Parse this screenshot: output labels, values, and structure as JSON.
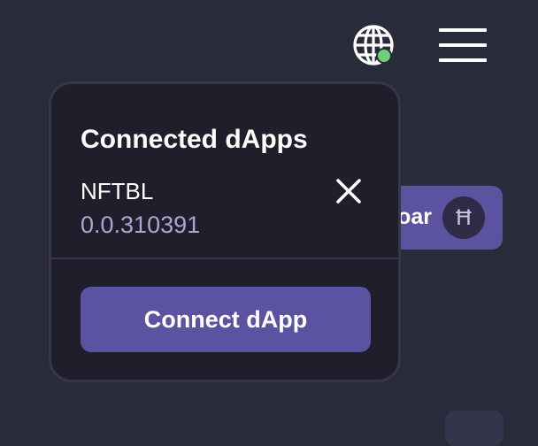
{
  "header": {
    "globe_icon": "globe-icon",
    "status_color": "#6fcf79",
    "menu_icon": "hamburger-menu-icon"
  },
  "account_pill": {
    "text_fragment": "oar",
    "currency_symbol": "Ħ"
  },
  "popover": {
    "title": "Connected dApps",
    "items": [
      {
        "name": "NFTBL",
        "account_id": "0.0.310391"
      }
    ],
    "connect_label": "Connect dApp"
  },
  "colors": {
    "background": "#2a2b3a",
    "popover_bg": "#1f1f2b",
    "accent": "#5b53a2",
    "account_id_text": "#a9a6d4"
  }
}
